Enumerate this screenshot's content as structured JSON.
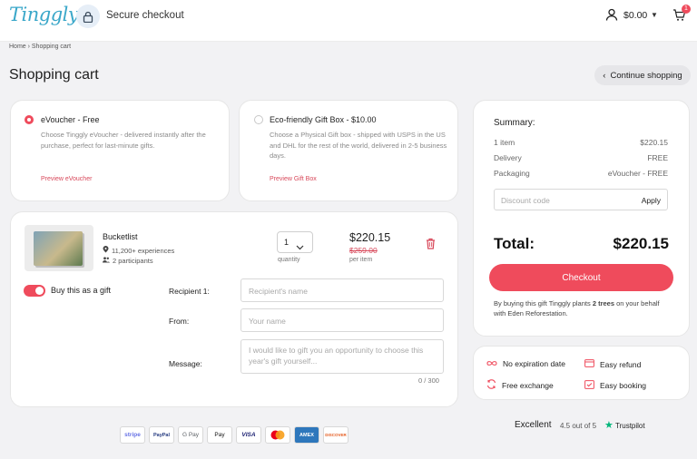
{
  "header": {
    "logo": "Tinggly",
    "secure_text": "Secure checkout",
    "balance": "$0.00",
    "cart_count": "1"
  },
  "breadcrumb": "Home › Shopping cart",
  "page_title": "Shopping cart",
  "continue_shopping": "Continue shopping",
  "voucher_options": [
    {
      "title": "eVoucher - Free",
      "description": "Choose Tinggly eVoucher - delivered instantly after the purchase, perfect for last-minute gifts.",
      "link": "Preview eVoucher",
      "selected": true
    },
    {
      "title": "Eco-friendly Gift Box - $10.00",
      "description": "Choose a Physical Gift box - shipped with USPS in the US and DHL for the rest of the world, delivered in 2-5 business days.",
      "link": "Preview Gift Box",
      "selected": false
    }
  ],
  "product": {
    "name": "Bucketlist",
    "experiences": "11,200+ experiences",
    "participants": "2 participants",
    "quantity": "1",
    "quantity_label": "quantity",
    "price": "$220.15",
    "old_price": "$259.00",
    "per_item": "per item"
  },
  "gift": {
    "toggle_label": "Buy this as a gift",
    "toggle_on": true,
    "recipient_label": "Recipient 1:",
    "recipient_placeholder": "Recipient's name",
    "from_label": "From:",
    "from_placeholder": "Your name",
    "message_label": "Message:",
    "message_placeholder": "I would like to gift you an opportunity to choose this year's gift yourself...",
    "char_counter": "0 / 300"
  },
  "summary": {
    "title": "Summary:",
    "rows": [
      {
        "label": "1 item",
        "value": "$220.15"
      },
      {
        "label": "Delivery",
        "value": "FREE"
      },
      {
        "label": "Packaging",
        "value": "eVoucher - FREE"
      }
    ],
    "discount_placeholder": "Discount code",
    "apply_label": "Apply",
    "total_label": "Total:",
    "total_value": "$220.15",
    "checkout_label": "Checkout",
    "tree_note_prefix": "By buying this gift Tinggly plants ",
    "tree_note_bold": "2 trees",
    "tree_note_suffix": " on your behalf with Eden Reforestation."
  },
  "features": [
    {
      "label": "No expiration date",
      "icon": "infinity-icon"
    },
    {
      "label": "Easy refund",
      "icon": "card-icon"
    },
    {
      "label": "Free exchange",
      "icon": "exchange-icon"
    },
    {
      "label": "Easy booking",
      "icon": "calendar-check-icon"
    }
  ],
  "payments": [
    "stripe",
    "PayPal",
    "G Pay",
    "Pay",
    "VISA",
    "",
    "AMEX",
    "DISCOVER"
  ],
  "trustpilot": {
    "excellent": "Excellent",
    "rating": "4.5 out of 5",
    "brand": "Trustpilot"
  },
  "colors": {
    "accent": "#ef4b5c",
    "logo": "#3aa7c9",
    "trustpilot_green": "#00b67a"
  }
}
